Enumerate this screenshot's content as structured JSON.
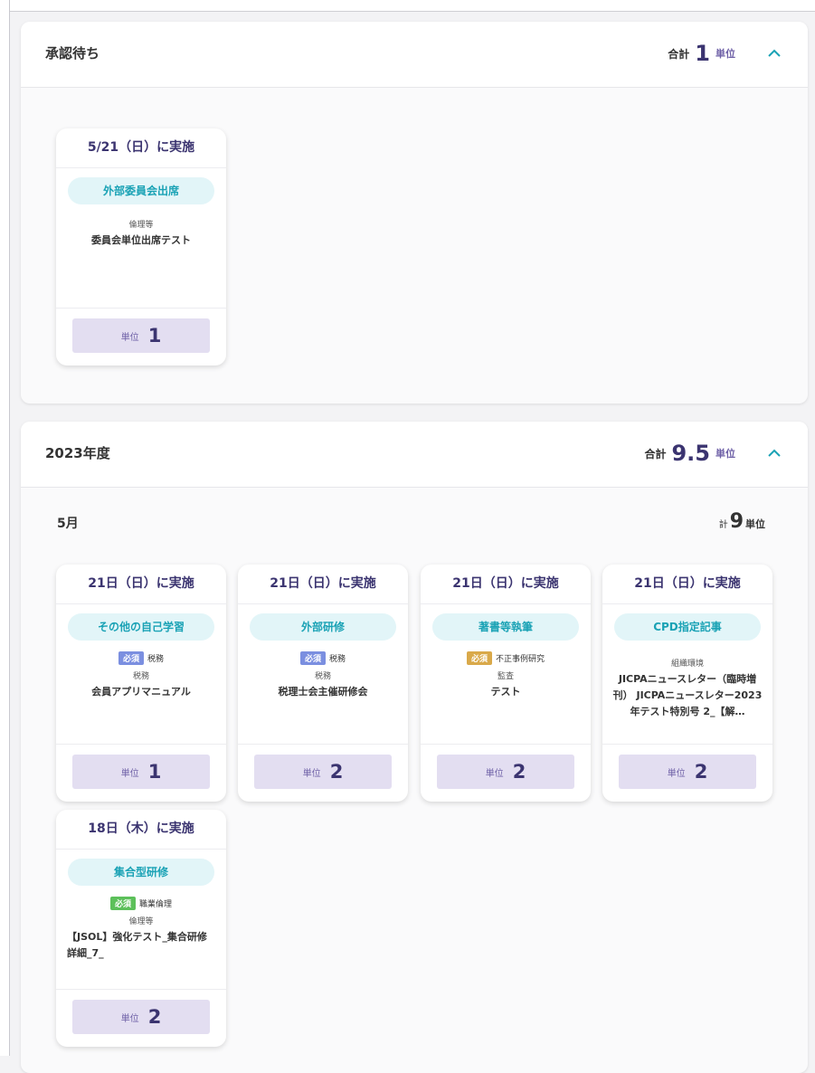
{
  "pending": {
    "title": "承認待ち",
    "total_label": "合計",
    "total_value": "1",
    "total_unit": "単位",
    "cards": [
      {
        "date": "5/21（日）に実施",
        "type": "外部委員会出席",
        "badge": "",
        "badge_subject": "",
        "category": "倫理等",
        "title": "委員会単位出席テスト",
        "unit_label": "単位",
        "unit_value": "1"
      }
    ]
  },
  "year": {
    "title": "2023年度",
    "total_label": "合計",
    "total_value": "9.5",
    "total_unit": "単位",
    "month": {
      "label": "5月",
      "total_prefix": "計",
      "total_value": "9",
      "total_unit": "単位"
    },
    "cards": [
      {
        "date": "21日（日）に実施",
        "type": "その他の自己学習",
        "badge": "必須",
        "badge_subject": "税務",
        "category": "税務",
        "title": "会員アプリマニュアル",
        "unit_label": "単位",
        "unit_value": "1"
      },
      {
        "date": "21日（日）に実施",
        "type": "外部研修",
        "badge": "必須",
        "badge_subject": "税務",
        "category": "税務",
        "title": "税理士会主催研修会",
        "unit_label": "単位",
        "unit_value": "2"
      },
      {
        "date": "21日（日）に実施",
        "type": "著書等執筆",
        "badge": "必須",
        "badge_subject": "不正事例研究",
        "category": "監査",
        "title": "テスト",
        "unit_label": "単位",
        "unit_value": "2"
      },
      {
        "date": "21日（日）に実施",
        "type": "CPD指定記事",
        "badge": "",
        "badge_subject": "",
        "category": "組織環境",
        "title": "JICPAニュースレター（臨時増刊） JICPAニュースレター2023年テスト特別号 2_【解…",
        "unit_label": "単位",
        "unit_value": "2"
      },
      {
        "date": "18日（木）に実施",
        "type": "集合型研修",
        "badge": "必須",
        "badge_subject": "職業倫理",
        "category": "倫理等",
        "title": "【JSOL】強化テスト_集合研修詳細_7_",
        "unit_label": "単位",
        "unit_value": "2"
      }
    ]
  },
  "colors": {
    "badge_tax": "#7b8fe0",
    "badge_audit": "#d9a94a",
    "badge_ethics": "#5cc05a",
    "pill_bg": "#e2f5f8",
    "pill_text": "#1aa2b5",
    "unit_bg": "#e3def1",
    "accent": "#3b3470"
  },
  "icons": {
    "collapse": "chevron-up-icon"
  }
}
